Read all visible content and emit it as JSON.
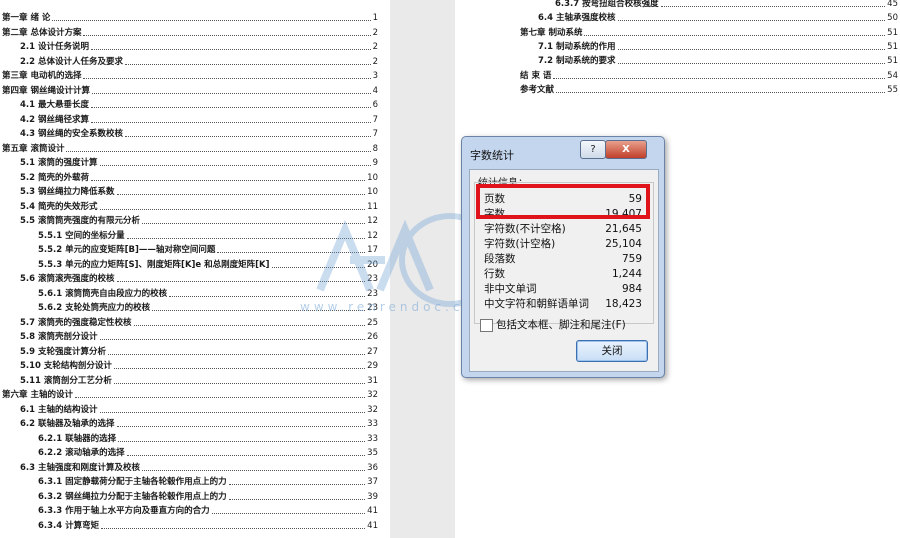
{
  "left_toc": [
    {
      "text": "第一章  绪    论",
      "page": "1",
      "level": 1,
      "bold": true
    },
    {
      "text": "第二章  总体设计方案",
      "page": "2",
      "level": 1,
      "bold": true
    },
    {
      "text": "2.1 设计任务说明",
      "page": "2",
      "level": 2,
      "bold": true
    },
    {
      "text": "2.2 总体设计人任务及要求",
      "page": "2",
      "level": 2,
      "bold": true
    },
    {
      "text": "第三章  电动机的选择",
      "page": "3",
      "level": 1,
      "bold": true
    },
    {
      "text": "第四章  钢丝绳设计计算",
      "page": "4",
      "level": 1,
      "bold": true
    },
    {
      "text": "4.1 最大悬垂长度",
      "page": "6",
      "level": 2,
      "bold": true
    },
    {
      "text": "4.2 钢丝绳径求算",
      "page": "7",
      "level": 2,
      "bold": true
    },
    {
      "text": "4.3 钢丝绳的安全系数校核",
      "page": "7",
      "level": 2,
      "bold": true
    },
    {
      "text": "第五章  滚筒设计",
      "page": "8",
      "level": 1,
      "bold": true
    },
    {
      "text": "5.1  滚筒的强度计算",
      "page": "9",
      "level": 2,
      "bold": true
    },
    {
      "text": "5.2 简壳的外载荷",
      "page": "10",
      "level": 2,
      "bold": true
    },
    {
      "text": "5.3  钢丝绳拉力降低系数",
      "page": "10",
      "level": 2,
      "bold": true
    },
    {
      "text": "5.4 简壳的失效形式",
      "page": "11",
      "level": 2,
      "bold": true
    },
    {
      "text": "5.5 滚筒筒壳强度的有限元分析",
      "page": "12",
      "level": 2,
      "bold": true
    },
    {
      "text": "5.5.1  空间的坐标分量",
      "page": "12",
      "level": 3,
      "bold": true
    },
    {
      "text": "5.5.2  单元的应变矩阵[B]——轴对称空间问题",
      "page": "17",
      "level": 3,
      "bold": true
    },
    {
      "text": "5.5.3  单元的应力矩阵[S]、刚度矩阵[K]e 和总刚度矩阵[K]",
      "page": "20",
      "level": 3,
      "bold": true
    },
    {
      "text": "5.6 滚筒滚壳强度的校核",
      "page": "23",
      "level": 2,
      "bold": true
    },
    {
      "text": "5.6.1 滚筒筒壳自由段应力的校核",
      "page": "23",
      "level": 3,
      "bold": true
    },
    {
      "text": "5.6.2 支轮处筒壳应力的校核",
      "page": "23",
      "level": 3,
      "bold": true
    },
    {
      "text": "5.7 滚筒壳的强度稳定性校核",
      "page": "25",
      "level": 2,
      "bold": true
    },
    {
      "text": "5.8 滚筒壳剖分设计",
      "page": "26",
      "level": 2,
      "bold": true
    },
    {
      "text": "5.9 支轮强度计算分析",
      "page": "27",
      "level": 2,
      "bold": true
    },
    {
      "text": "5.10  支轮结构剖分设计",
      "page": "29",
      "level": 2,
      "bold": true
    },
    {
      "text": "5.11  滚筒剖分工艺分析",
      "page": "31",
      "level": 2,
      "bold": true
    },
    {
      "text": "第六章  主轴的设计",
      "page": "32",
      "level": 1,
      "bold": true
    },
    {
      "text": "6.1 主轴的结构设计",
      "page": "32",
      "level": 2,
      "bold": true
    },
    {
      "text": "6.2 联轴器及轴承的选择",
      "page": "33",
      "level": 2,
      "bold": true
    },
    {
      "text": "6.2.1 联轴器的选择",
      "page": "33",
      "level": 3,
      "bold": true
    },
    {
      "text": "6.2.2 滚动轴承的选择",
      "page": "35",
      "level": 3,
      "bold": true
    },
    {
      "text": "6.3  主轴强度和刚度计算及校核",
      "page": "36",
      "level": 2,
      "bold": true
    },
    {
      "text": "6.3.1  固定静载荷分配于主轴各轮毂作用点上的力",
      "page": "37",
      "level": 3,
      "bold": true
    },
    {
      "text": "6.3.2  钢丝绳拉力分配于主轴各轮毂作用点上的力",
      "page": "39",
      "level": 3,
      "bold": true
    },
    {
      "text": "6.3.3  作用于轴上水平方向及垂直方向的合力",
      "page": "41",
      "level": 3,
      "bold": true
    },
    {
      "text": "6.3.4  计算弯矩",
      "page": "41",
      "level": 3,
      "bold": true
    }
  ],
  "right_toc": [
    {
      "text": "6.3.7 按弯扭组合校核强度",
      "page": "45",
      "level": 3,
      "bold": true
    },
    {
      "text": "6.4 主轴承强度校核",
      "page": "50",
      "level": 2,
      "bold": true
    },
    {
      "text": "第七章  制动系统",
      "page": "51",
      "level": 1,
      "bold": true
    },
    {
      "text": "7.1   制动系统的作用",
      "page": "51",
      "level": 2,
      "bold": true
    },
    {
      "text": "7.2   制动系统的要求",
      "page": "51",
      "level": 2,
      "bold": true
    },
    {
      "text": "结  束  语",
      "page": "54",
      "level": 1,
      "bold": true
    },
    {
      "text": "参考文献",
      "page": "55",
      "level": 1,
      "bold": true
    }
  ],
  "dialog": {
    "title": "字数统计",
    "help_label": "?",
    "close_label": "X",
    "stats_label": "统计信息：",
    "stats": [
      {
        "key": "页数",
        "value": "59"
      },
      {
        "key": "字数",
        "value": "19,407"
      },
      {
        "key": "字符数(不计空格)",
        "value": "21,645"
      },
      {
        "key": "字符数(计空格)",
        "value": "25,104"
      },
      {
        "key": "段落数",
        "value": "759"
      },
      {
        "key": "行数",
        "value": "1,244"
      },
      {
        "key": "非中文单词",
        "value": "984"
      },
      {
        "key": "中文字符和朝鲜语单词",
        "value": "18,423"
      }
    ],
    "checkbox_label": "包括文本框、脚注和尾注(F)",
    "close_button": "关闭",
    "highlight_color": "#e0121a"
  },
  "watermark": {
    "text": "www.renrendoc.com"
  }
}
